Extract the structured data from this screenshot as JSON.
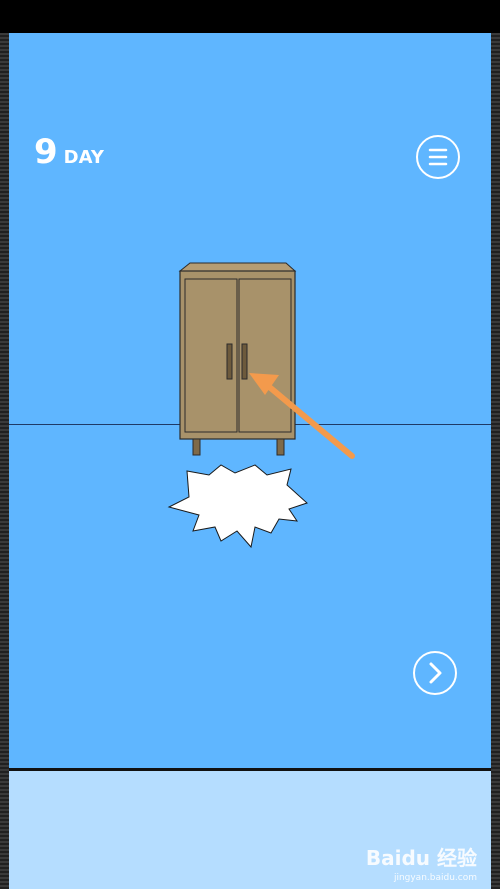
{
  "hud": {
    "day_number": "9",
    "day_label": "DAY"
  },
  "icons": {
    "menu": "hamburger-menu-icon",
    "next": "chevron-right-icon"
  },
  "scene": {
    "object": "wardrobe",
    "pointer": "orange-arrow",
    "effect": "white-burst"
  },
  "colors": {
    "sky": "#5fb6ff",
    "panel": "#b5ddff",
    "wardrobe": "#a8926a",
    "arrow": "#f39a4c"
  },
  "watermark": {
    "main": "Bai⁢du 经验",
    "sub": "jingyan.baidu.com"
  }
}
